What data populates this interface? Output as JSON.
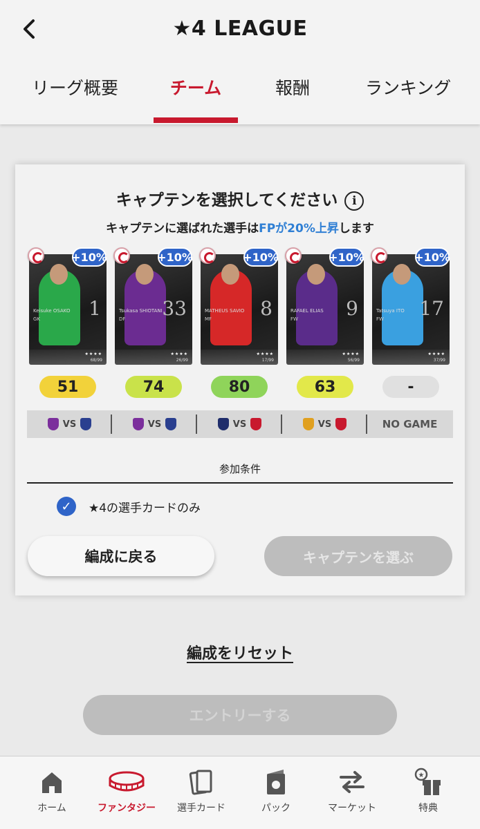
{
  "header": {
    "title": "★4 LEAGUE",
    "tabs": [
      {
        "label": "リーグ概要"
      },
      {
        "label": "チーム"
      },
      {
        "label": "報酬"
      },
      {
        "label": "ランキング"
      }
    ],
    "active_tab": "チーム"
  },
  "modal": {
    "title": "キャプテンを選択してください",
    "subtitle_pre": "キャプテンに選ばれた選手は",
    "subtitle_hl": "FPが20%上昇",
    "subtitle_post": "します",
    "bonus_label": "+10%",
    "cards": [
      {
        "name": "Keisuke OSAKO",
        "position": "GK",
        "number": "1",
        "rating": "68/99",
        "kit_color": "#2aa84a",
        "score": "51",
        "score_color": "#f2d23a",
        "match": {
          "home_color": "#7b2f9c",
          "vs": "VS",
          "away_color": "#2a3f8f"
        }
      },
      {
        "name": "Tsukasa SHIOTANI",
        "position": "DF",
        "number": "33",
        "rating": "26/99",
        "kit_color": "#6b2c91",
        "score": "74",
        "score_color": "#c9e24a",
        "match": {
          "home_color": "#7b2f9c",
          "vs": "VS",
          "away_color": "#2a3f8f"
        }
      },
      {
        "name": "MATHEUS SAVIO",
        "position": "MF",
        "number": "8",
        "rating": "17/99",
        "kit_color": "#d62828",
        "score": "80",
        "score_color": "#8fd45a",
        "match": {
          "home_color": "#1f2d6b",
          "vs": "VS",
          "away_color": "#c8192e"
        }
      },
      {
        "name": "RAFAEL ELIAS",
        "position": "FW",
        "number": "9",
        "rating": "56/99",
        "kit_color": "#5a2c8a",
        "score": "63",
        "score_color": "#e2e84a",
        "match": {
          "home_color": "#e0a020",
          "vs": "VS",
          "away_color": "#c8192e"
        }
      },
      {
        "name": "Tatsuya ITO",
        "position": "FW",
        "number": "17",
        "rating": "37/99",
        "kit_color": "#3aa0e0",
        "score": "-",
        "score_color": "#e0e0e0",
        "match": {
          "text": "NO GAME"
        }
      }
    ],
    "condition_label": "参加条件",
    "condition_item": "★4の選手カードのみ",
    "btn_back": "編成に戻る",
    "btn_choose": "キャプテンを選ぶ"
  },
  "reset_link": "編成をリセット",
  "entry_button": "エントリーする",
  "bottom_nav": [
    {
      "label": "ホーム",
      "icon": "home-icon"
    },
    {
      "label": "ファンタジー",
      "icon": "stadium-icon"
    },
    {
      "label": "選手カード",
      "icon": "cards-icon"
    },
    {
      "label": "パック",
      "icon": "pack-icon"
    },
    {
      "label": "マーケット",
      "icon": "exchange-icon"
    },
    {
      "label": "特典",
      "icon": "gift-icon"
    }
  ],
  "accent_color": "#c8192e",
  "blue_color": "#2f64c8"
}
